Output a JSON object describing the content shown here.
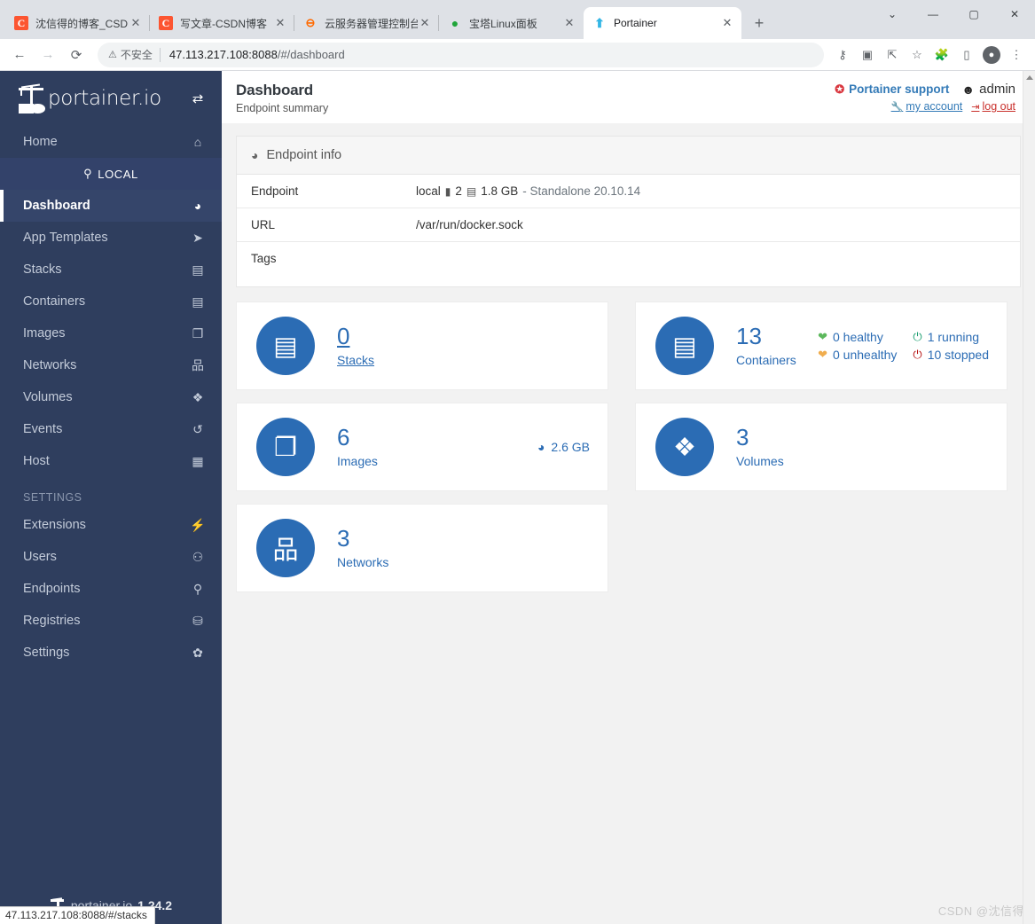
{
  "browser": {
    "tabs": [
      {
        "title": "沈信得的博客_CSDN博客",
        "favicon": "csdn-icon",
        "active": false
      },
      {
        "title": "写文章-CSDN博客",
        "favicon": "csdn-icon",
        "active": false
      },
      {
        "title": "云服务器管理控制台",
        "favicon": "alibaba-icon",
        "active": false
      },
      {
        "title": "宝塔Linux面板",
        "favicon": "bt-panel-icon",
        "active": false
      },
      {
        "title": "Portainer",
        "favicon": "portainer-icon",
        "active": true
      }
    ],
    "new_tab_label": "+",
    "tab_close_label": "✕",
    "window_controls": {
      "list": "⌄",
      "minimize": "—",
      "maximize": "▢",
      "close": "✕"
    },
    "nav": {
      "back": "←",
      "forward": "→",
      "reload": "⟳"
    },
    "omnibox": {
      "security_icon": "⚠",
      "security_label": "不安全",
      "url_host": "47.113.217.108:8088",
      "url_path": "/#/dashboard"
    },
    "toolbar_icons": [
      "password-key-icon",
      "translate-icon",
      "share-icon",
      "bookmark-star-icon",
      "extensions-puzzle-icon",
      "side-panel-icon",
      "profile-avatar-icon",
      "chrome-menu-icon"
    ],
    "status_bubble": "47.113.217.108:8088/#/stacks"
  },
  "sidebar": {
    "brand": "portainer.io",
    "switch_endpoint_icon": "switch-endpoint-icon",
    "home": {
      "label": "Home",
      "icon": "home-icon"
    },
    "endpoint_badge": {
      "label": "LOCAL",
      "icon": "plug-icon"
    },
    "items": [
      {
        "label": "Dashboard",
        "icon": "tachometer-icon",
        "active": true
      },
      {
        "label": "App Templates",
        "icon": "rocket-icon",
        "active": false
      },
      {
        "label": "Stacks",
        "icon": "list-icon",
        "active": false
      },
      {
        "label": "Containers",
        "icon": "server-icon",
        "active": false
      },
      {
        "label": "Images",
        "icon": "clone-icon",
        "active": false
      },
      {
        "label": "Networks",
        "icon": "sitemap-icon",
        "active": false
      },
      {
        "label": "Volumes",
        "icon": "cubes-icon",
        "active": false
      },
      {
        "label": "Events",
        "icon": "history-icon",
        "active": false
      },
      {
        "label": "Host",
        "icon": "th-icon",
        "active": false
      }
    ],
    "section_settings": "SETTINGS",
    "settings_items": [
      {
        "label": "Extensions",
        "icon": "bolt-icon"
      },
      {
        "label": "Users",
        "icon": "users-icon"
      },
      {
        "label": "Endpoints",
        "icon": "plug-icon"
      },
      {
        "label": "Registries",
        "icon": "database-icon"
      },
      {
        "label": "Settings",
        "icon": "cogs-icon"
      }
    ],
    "footer": {
      "brand": "portainer.io",
      "version": "1.24.2"
    }
  },
  "header": {
    "title": "Dashboard",
    "subtitle": "Endpoint summary",
    "support_label": "Portainer support",
    "support_icon": "life-ring-icon",
    "user_label": "admin",
    "user_icon": "user-circle-icon",
    "my_account_label": "my account",
    "my_account_icon": "wrench-icon",
    "logout_label": "log out",
    "logout_icon": "sign-out-icon"
  },
  "endpoint_info": {
    "panel_title": "Endpoint info",
    "panel_icon": "tachometer-icon",
    "rows": [
      {
        "key": "Endpoint",
        "value": "local",
        "cpu_icon": "microchip-icon",
        "cpu": "2",
        "mem_icon": "memory-icon",
        "mem": "1.8 GB",
        "extra": "- Standalone 20.10.14"
      },
      {
        "key": "URL",
        "value": "/var/run/docker.sock"
      },
      {
        "key": "Tags",
        "value": ""
      }
    ]
  },
  "dashboard_cards": [
    {
      "name": "stacks",
      "count": "0",
      "label": "Stacks",
      "icon": "th-list-icon",
      "hovered": true
    },
    {
      "name": "containers",
      "count": "13",
      "label": "Containers",
      "icon": "server-icon",
      "stats": [
        {
          "icon": "heartbeat-icon",
          "tone": "green",
          "text": "0 healthy"
        },
        {
          "icon": "power-icon",
          "tone": "ok",
          "text": "1 running"
        },
        {
          "icon": "heartbeat-icon",
          "tone": "orange",
          "text": "0 unhealthy"
        },
        {
          "icon": "power-icon",
          "tone": "red",
          "text": "10 stopped"
        }
      ]
    },
    {
      "name": "images",
      "count": "6",
      "label": "Images",
      "icon": "clone-icon",
      "size_icon": "pie-chart-icon",
      "size": "2.6 GB"
    },
    {
      "name": "volumes",
      "count": "3",
      "label": "Volumes",
      "icon": "cubes-icon"
    },
    {
      "name": "networks",
      "count": "3",
      "label": "Networks",
      "icon": "sitemap-icon"
    }
  ],
  "watermark": "CSDN @沈信得",
  "colors": {
    "sidebar_bg": "#2f3e5e",
    "sidebar_active": "#35456a",
    "accent_blue": "#2b6cb4",
    "link_blue": "#337ab7",
    "danger_red": "#c9302c",
    "page_bg": "#f2f2f2"
  }
}
